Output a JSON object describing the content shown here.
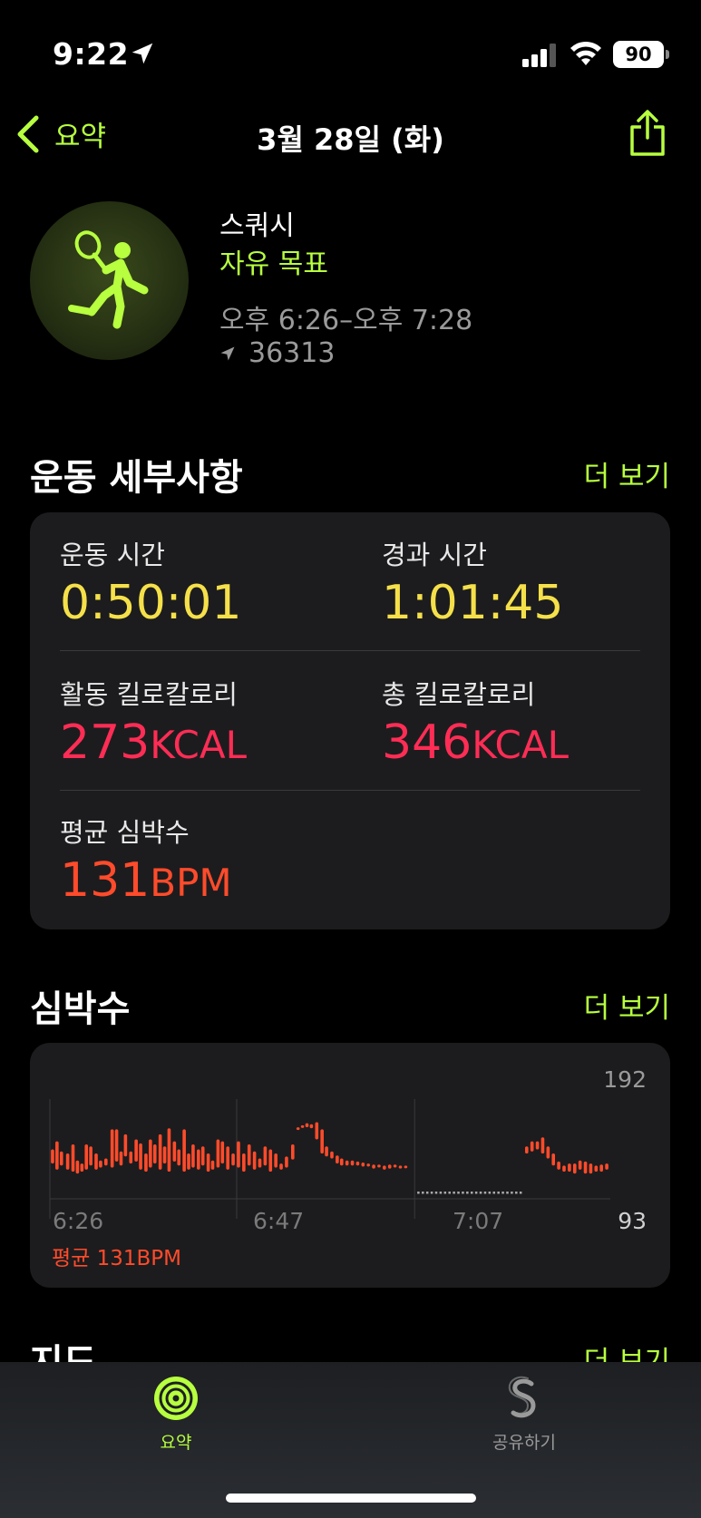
{
  "status_bar": {
    "time": "9:22",
    "battery": "90"
  },
  "nav": {
    "back_label": "요약",
    "title": "3월 28일 (화)"
  },
  "workout": {
    "title": "스쿼시",
    "goal": "자유 목표",
    "time_range": "오후 6:26–오후 7:28",
    "location": "36313"
  },
  "details": {
    "heading": "운동 세부사항",
    "more": "더 보기",
    "duration_label": "운동 시간",
    "duration_value": "0:50:01",
    "elapsed_label": "경과 시간",
    "elapsed_value": "1:01:45",
    "active_kcal_label": "활동 킬로칼로리",
    "active_kcal_value": "273",
    "total_kcal_label": "총 킬로칼로리",
    "total_kcal_value": "346",
    "kcal_unit": "KCAL",
    "avg_hr_label": "평균 심박수",
    "avg_hr_value": "131",
    "bpm_unit": "BPM"
  },
  "heart_rate": {
    "heading": "심박수",
    "more": "더 보기",
    "avg_label": "평균 131BPM"
  },
  "chart_data": {
    "type": "bar",
    "y_max_label": "192",
    "y_min_label": "93",
    "ylim": [
      93,
      192
    ],
    "x_tick_labels": [
      "6:26",
      "6:47",
      "7:07"
    ],
    "x_range_minutes": [
      0,
      63
    ],
    "x_ticks_minutes": [
      0,
      21,
      41
    ],
    "gap_minutes": [
      41,
      53
    ],
    "samples": [
      {
        "t": 0.3,
        "lo": 128,
        "hi": 142
      },
      {
        "t": 0.8,
        "lo": 122,
        "hi": 150
      },
      {
        "t": 1.3,
        "lo": 126,
        "hi": 140
      },
      {
        "t": 2.0,
        "lo": 122,
        "hi": 138
      },
      {
        "t": 2.6,
        "lo": 120,
        "hi": 147
      },
      {
        "t": 3.1,
        "lo": 118,
        "hi": 131
      },
      {
        "t": 3.6,
        "lo": 120,
        "hi": 128
      },
      {
        "t": 4.1,
        "lo": 122,
        "hi": 147
      },
      {
        "t": 4.6,
        "lo": 126,
        "hi": 145
      },
      {
        "t": 5.2,
        "lo": 122,
        "hi": 138
      },
      {
        "t": 5.7,
        "lo": 124,
        "hi": 131
      },
      {
        "t": 6.3,
        "lo": 126,
        "hi": 133
      },
      {
        "t": 7.0,
        "lo": 124,
        "hi": 162
      },
      {
        "t": 7.5,
        "lo": 130,
        "hi": 162
      },
      {
        "t": 8.0,
        "lo": 126,
        "hi": 140
      },
      {
        "t": 8.5,
        "lo": 135,
        "hi": 157
      },
      {
        "t": 9.1,
        "lo": 128,
        "hi": 140
      },
      {
        "t": 9.7,
        "lo": 130,
        "hi": 152
      },
      {
        "t": 10.2,
        "lo": 122,
        "hi": 148
      },
      {
        "t": 10.8,
        "lo": 120,
        "hi": 138
      },
      {
        "t": 11.3,
        "lo": 124,
        "hi": 152
      },
      {
        "t": 11.8,
        "lo": 128,
        "hi": 147
      },
      {
        "t": 12.4,
        "lo": 122,
        "hi": 157
      },
      {
        "t": 12.9,
        "lo": 128,
        "hi": 145
      },
      {
        "t": 13.4,
        "lo": 120,
        "hi": 163
      },
      {
        "t": 14.0,
        "lo": 130,
        "hi": 150
      },
      {
        "t": 14.5,
        "lo": 126,
        "hi": 142
      },
      {
        "t": 15.1,
        "lo": 120,
        "hi": 162
      },
      {
        "t": 15.6,
        "lo": 122,
        "hi": 138
      },
      {
        "t": 16.1,
        "lo": 124,
        "hi": 147
      },
      {
        "t": 16.7,
        "lo": 122,
        "hi": 142
      },
      {
        "t": 17.2,
        "lo": 126,
        "hi": 145
      },
      {
        "t": 17.8,
        "lo": 120,
        "hi": 138
      },
      {
        "t": 18.3,
        "lo": 122,
        "hi": 131
      },
      {
        "t": 18.9,
        "lo": 124,
        "hi": 152
      },
      {
        "t": 19.4,
        "lo": 128,
        "hi": 150
      },
      {
        "t": 20.0,
        "lo": 122,
        "hi": 145
      },
      {
        "t": 20.6,
        "lo": 126,
        "hi": 138
      },
      {
        "t": 21.2,
        "lo": 124,
        "hi": 150
      },
      {
        "t": 21.8,
        "lo": 120,
        "hi": 138
      },
      {
        "t": 22.4,
        "lo": 126,
        "hi": 147
      },
      {
        "t": 23.0,
        "lo": 122,
        "hi": 140
      },
      {
        "t": 23.6,
        "lo": 124,
        "hi": 133
      },
      {
        "t": 24.2,
        "lo": 126,
        "hi": 145
      },
      {
        "t": 24.8,
        "lo": 120,
        "hi": 142
      },
      {
        "t": 25.4,
        "lo": 124,
        "hi": 138
      },
      {
        "t": 26.0,
        "lo": 122,
        "hi": 128
      },
      {
        "t": 26.6,
        "lo": 124,
        "hi": 135
      },
      {
        "t": 27.3,
        "lo": 132,
        "hi": 147
      },
      {
        "t": 27.9,
        "lo": 162,
        "hi": 164
      },
      {
        "t": 28.4,
        "lo": 164,
        "hi": 166
      },
      {
        "t": 28.9,
        "lo": 164,
        "hi": 168
      },
      {
        "t": 29.4,
        "lo": 163,
        "hi": 167
      },
      {
        "t": 30.0,
        "lo": 152,
        "hi": 169
      },
      {
        "t": 30.6,
        "lo": 138,
        "hi": 162
      },
      {
        "t": 31.1,
        "lo": 135,
        "hi": 145
      },
      {
        "t": 31.7,
        "lo": 133,
        "hi": 140
      },
      {
        "t": 32.3,
        "lo": 128,
        "hi": 136
      },
      {
        "t": 32.8,
        "lo": 126,
        "hi": 133
      },
      {
        "t": 33.4,
        "lo": 126,
        "hi": 131
      },
      {
        "t": 34.0,
        "lo": 126,
        "hi": 131
      },
      {
        "t": 34.6,
        "lo": 126,
        "hi": 130
      },
      {
        "t": 35.2,
        "lo": 125,
        "hi": 129
      },
      {
        "t": 35.8,
        "lo": 125,
        "hi": 128
      },
      {
        "t": 36.4,
        "lo": 123,
        "hi": 127
      },
      {
        "t": 37.0,
        "lo": 124,
        "hi": 127
      },
      {
        "t": 37.6,
        "lo": 122,
        "hi": 126
      },
      {
        "t": 38.2,
        "lo": 123,
        "hi": 127
      },
      {
        "t": 38.8,
        "lo": 124,
        "hi": 127
      },
      {
        "t": 39.4,
        "lo": 123,
        "hi": 126
      },
      {
        "t": 40.0,
        "lo": 124,
        "hi": 126
      },
      {
        "t": 53.6,
        "lo": 138,
        "hi": 145
      },
      {
        "t": 54.2,
        "lo": 140,
        "hi": 150
      },
      {
        "t": 54.8,
        "lo": 142,
        "hi": 150
      },
      {
        "t": 55.4,
        "lo": 138,
        "hi": 154
      },
      {
        "t": 56.0,
        "lo": 133,
        "hi": 145
      },
      {
        "t": 56.6,
        "lo": 126,
        "hi": 138
      },
      {
        "t": 57.2,
        "lo": 122,
        "hi": 130
      },
      {
        "t": 57.8,
        "lo": 120,
        "hi": 126
      },
      {
        "t": 58.4,
        "lo": 120,
        "hi": 128
      },
      {
        "t": 59.0,
        "lo": 118,
        "hi": 128
      },
      {
        "t": 59.6,
        "lo": 122,
        "hi": 131
      },
      {
        "t": 60.2,
        "lo": 118,
        "hi": 130
      },
      {
        "t": 60.8,
        "lo": 118,
        "hi": 128
      },
      {
        "t": 61.4,
        "lo": 120,
        "hi": 126
      },
      {
        "t": 62.0,
        "lo": 120,
        "hi": 127
      },
      {
        "t": 62.6,
        "lo": 122,
        "hi": 128
      }
    ],
    "colors": {
      "bars": "#ff4b2b",
      "gap_dots": "#aaaaaa",
      "grid": "#3a3a3c"
    }
  },
  "map_section": {
    "heading": "지도",
    "more": "더 보기"
  },
  "tabs": [
    {
      "label": "요약",
      "icon": "activity-rings-icon",
      "active": true
    },
    {
      "label": "공유하기",
      "icon": "sharing-icon",
      "active": false
    }
  ],
  "colors": {
    "accent": "#b7ff3f",
    "yellow": "#f5e04a",
    "kcal": "#ff2d55",
    "heart": "#ff4b2b"
  }
}
